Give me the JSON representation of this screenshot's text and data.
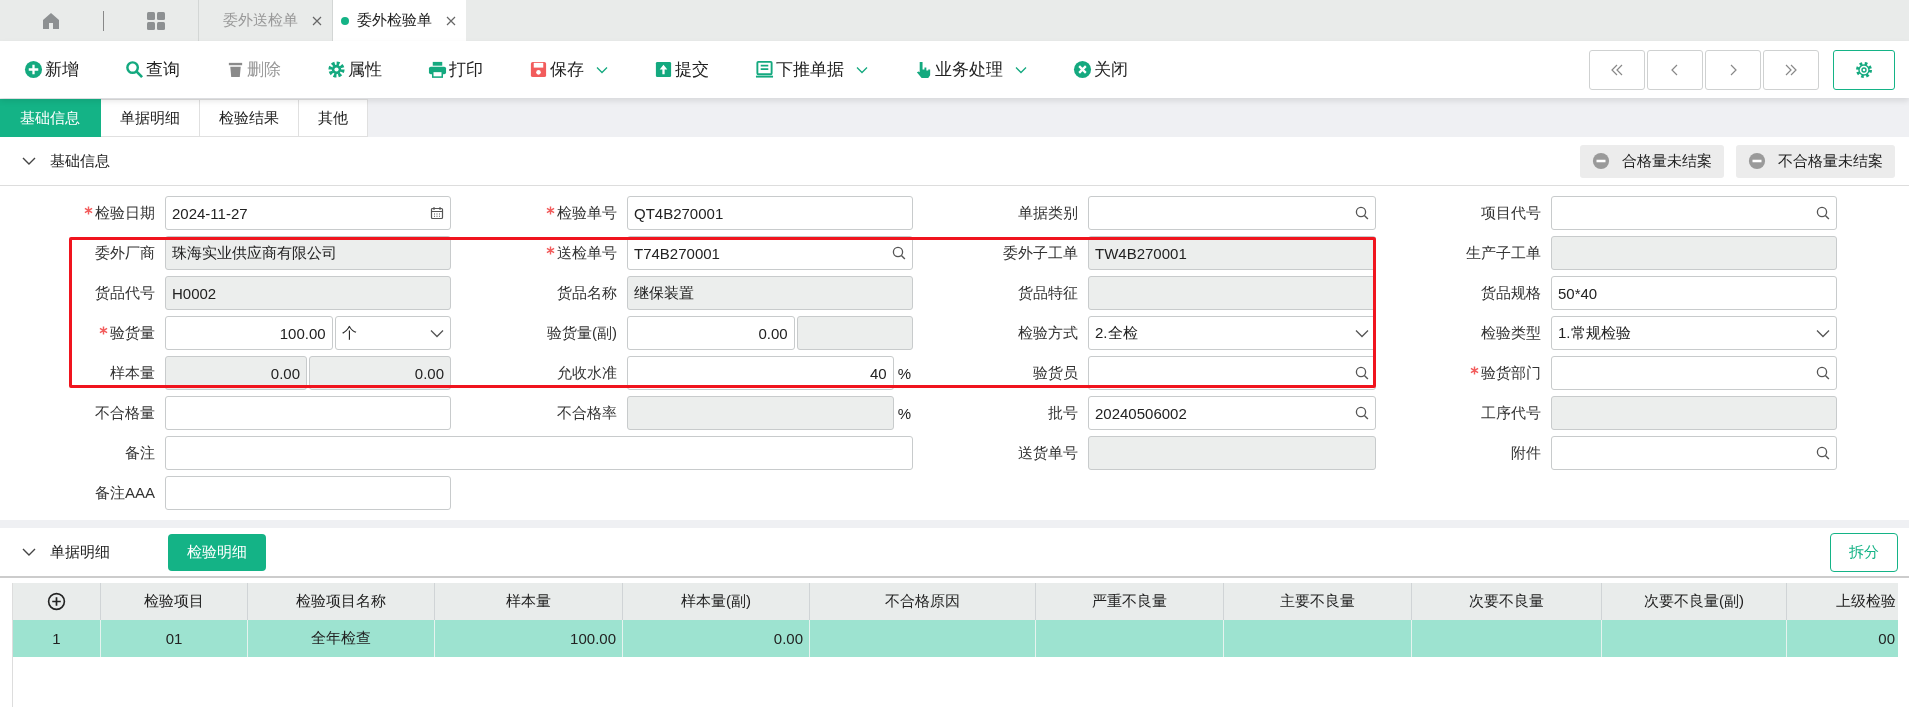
{
  "tab_bar": {
    "tabs": [
      {
        "label": "委外送检单",
        "selected": false
      },
      {
        "label": "委外检验单",
        "selected": true
      }
    ]
  },
  "toolbar": {
    "actions": [
      {
        "label": "新增",
        "disabled": false,
        "dropdown": false
      },
      {
        "label": "查询",
        "disabled": false,
        "dropdown": false
      },
      {
        "label": "删除",
        "disabled": true,
        "dropdown": false
      },
      {
        "label": "属性",
        "disabled": false,
        "dropdown": false
      },
      {
        "label": "打印",
        "disabled": false,
        "dropdown": false
      },
      {
        "label": "保存",
        "disabled": false,
        "dropdown": true
      },
      {
        "label": "提交",
        "disabled": false,
        "dropdown": false
      },
      {
        "label": "下推单据",
        "disabled": false,
        "dropdown": true
      },
      {
        "label": "业务处理",
        "disabled": false,
        "dropdown": true
      },
      {
        "label": "关闭",
        "disabled": false,
        "dropdown": false
      }
    ]
  },
  "form_tabs": [
    {
      "label": "基础信息",
      "selected": true
    },
    {
      "label": "单据明细",
      "selected": false
    },
    {
      "label": "检验结果",
      "selected": false
    },
    {
      "label": "其他",
      "selected": false
    }
  ],
  "basic_section": {
    "title": "基础信息",
    "expanded": true,
    "buttons": [
      "合格量未结案",
      "不合格量未结案"
    ],
    "fields": [
      {
        "label": "检验日期",
        "required": true,
        "inputs": [
          {
            "kind": "date",
            "value": "2024-11-27",
            "disabled": false
          }
        ]
      },
      {
        "label": "检验单号",
        "required": true,
        "inputs": [
          {
            "kind": "text",
            "value": "QT4B270001",
            "disabled": false
          }
        ]
      },
      {
        "label": "单据类别",
        "required": false,
        "inputs": [
          {
            "kind": "search",
            "disabled": false
          }
        ]
      },
      {
        "label": "项目代号",
        "required": false,
        "inputs": [
          {
            "kind": "search",
            "disabled": false
          }
        ]
      },
      {
        "label": "委外厂商",
        "required": false,
        "inputs": [
          {
            "kind": "text",
            "value": "珠海实业供应商有限公司",
            "disabled": true
          }
        ]
      },
      {
        "label": "送检单号",
        "required": true,
        "inputs": [
          {
            "kind": "search",
            "value": "T74B270001",
            "disabled": false
          }
        ]
      },
      {
        "label": "委外子工单",
        "required": false,
        "inputs": [
          {
            "kind": "text",
            "value": "TW4B270001",
            "disabled": true
          }
        ]
      },
      {
        "label": "生产子工单",
        "required": false,
        "inputs": [
          {
            "kind": "text",
            "disabled": true
          }
        ]
      },
      {
        "label": "货品代号",
        "required": false,
        "inputs": [
          {
            "kind": "text",
            "value": "H0002",
            "disabled": true
          }
        ]
      },
      {
        "label": "货品名称",
        "required": false,
        "inputs": [
          {
            "kind": "text",
            "value": "继保装置",
            "disabled": true
          }
        ]
      },
      {
        "label": "货品特征",
        "required": false,
        "inputs": [
          {
            "kind": "text",
            "disabled": true
          }
        ]
      },
      {
        "label": "货品规格",
        "required": false,
        "inputs": [
          {
            "kind": "text",
            "value": "50*40",
            "disabled": false
          }
        ]
      },
      {
        "label": "验货量",
        "required": true,
        "inputs": [
          {
            "kind": "number",
            "value": "100.00",
            "disabled": false
          },
          {
            "kind": "select",
            "value": "个",
            "disabled": false
          }
        ]
      },
      {
        "label": "验货量(副)",
        "required": false,
        "inputs": [
          {
            "kind": "number",
            "value": "0.00",
            "disabled": false
          },
          {
            "kind": "text",
            "disabled": true
          }
        ]
      },
      {
        "label": "检验方式",
        "required": false,
        "inputs": [
          {
            "kind": "select",
            "value": "2.全检",
            "disabled": false
          }
        ]
      },
      {
        "label": "检验类型",
        "required": false,
        "inputs": [
          {
            "kind": "select",
            "value": "1.常规检验",
            "disabled": false
          }
        ]
      },
      {
        "label": "样本量",
        "required": false,
        "inputs": [
          {
            "kind": "number",
            "value": "0.00",
            "disabled": true
          },
          {
            "kind": "number",
            "value": "0.00",
            "disabled": true
          }
        ]
      },
      {
        "label": "允收水准",
        "required": false,
        "suffix": "%",
        "inputs": [
          {
            "kind": "number",
            "value": "40",
            "disabled": false
          }
        ]
      },
      {
        "label": "验货员",
        "required": false,
        "inputs": [
          {
            "kind": "search",
            "disabled": false
          }
        ]
      },
      {
        "label": "验货部门",
        "required": true,
        "inputs": [
          {
            "kind": "search",
            "disabled": false
          }
        ]
      },
      {
        "label": "不合格量",
        "required": false,
        "inputs": [
          {
            "kind": "text",
            "disabled": false
          }
        ]
      },
      {
        "label": "不合格率",
        "required": false,
        "suffix": "%",
        "inputs": [
          {
            "kind": "text",
            "disabled": true
          }
        ]
      },
      {
        "label": "批号",
        "required": false,
        "inputs": [
          {
            "kind": "search",
            "value": "20240506002",
            "disabled": false
          }
        ]
      },
      {
        "label": "工序代号",
        "required": false,
        "inputs": [
          {
            "kind": "text",
            "disabled": true
          }
        ]
      },
      {
        "label": "备注",
        "required": false,
        "wide": true,
        "inputs": [
          {
            "kind": "text",
            "disabled": false
          }
        ]
      },
      {
        "label": "送货单号",
        "required": false,
        "inputs": [
          {
            "kind": "text",
            "disabled": true
          }
        ]
      },
      {
        "label": "附件",
        "required": false,
        "inputs": [
          {
            "kind": "search",
            "disabled": false
          }
        ]
      },
      {
        "label": "备注AAA",
        "required": false,
        "inputs": [
          {
            "kind": "text",
            "disabled": false
          }
        ]
      }
    ]
  },
  "detail_section": {
    "title": "单据明细",
    "expanded": true,
    "tab_button": "检验明细",
    "split_button": "拆分",
    "table": {
      "columns": [
        "检验项目",
        "检验项目名称",
        "样本量",
        "样本量(副)",
        "不合格原因",
        "严重不良量",
        "主要不良量",
        "次要不良量",
        "次要不良量(副)",
        "上级检验"
      ],
      "rows": [
        {
          "index": "1",
          "selected": true,
          "cells": [
            "01",
            "全年检查",
            "100.00",
            "0.00",
            null,
            null,
            null,
            null,
            null,
            "00"
          ]
        }
      ]
    }
  }
}
